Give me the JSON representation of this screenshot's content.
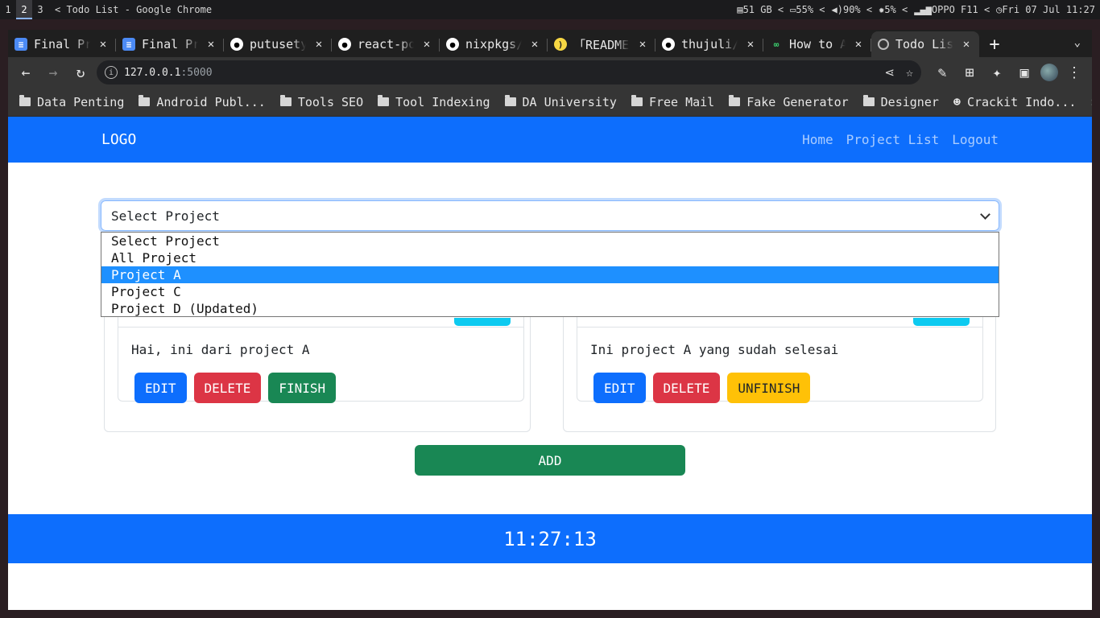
{
  "wm": {
    "workspaces": [
      "1",
      "2",
      "3"
    ],
    "title": "< Todo List - Google Chrome",
    "status": {
      "disk": "51 GB <",
      "battery": "55% <",
      "volume": "90% <",
      "brightness": "5% <",
      "network": "OPPO F11 <",
      "clock": "Fri 07 Jul 11:27"
    }
  },
  "browser": {
    "tabs": [
      {
        "title": "Final Pro",
        "icon": "doc-icon"
      },
      {
        "title": "Final Pro",
        "icon": "doc-icon"
      },
      {
        "title": "putusetya",
        "icon": "github-icon"
      },
      {
        "title": "react-por",
        "icon": "github-icon"
      },
      {
        "title": "nixpkgs/R",
        "icon": "github-icon"
      },
      {
        "title": "「README」",
        "icon": "banana-icon"
      },
      {
        "title": "thujuli/t",
        "icon": "github-icon"
      },
      {
        "title": "How to Ad",
        "icon": "geeks-icon"
      },
      {
        "title": "Todo List",
        "icon": "globe-icon"
      }
    ],
    "url_host": "127.0.0.1",
    "url_port": ":5000",
    "bookmarks": [
      "Data Penting",
      "Android Publ...",
      "Tools SEO",
      "Tool Indexing",
      "DA University",
      "Free Mail",
      "Fake Generator",
      "Designer",
      "Crackit Indo..."
    ],
    "bookmarks_more": "»"
  },
  "navbar": {
    "logo": "LOGO",
    "links": [
      "Home",
      "Project List",
      "Logout"
    ]
  },
  "project_select": {
    "value": "Select Project",
    "options": [
      "Select Project",
      "All Project",
      "Project A",
      "Project C",
      "Project D (Updated)"
    ],
    "highlighted": "Project A"
  },
  "cards": [
    {
      "text": "Hai, ini dari project A",
      "buttons": [
        "EDIT",
        "DELETE",
        "FINISH"
      ]
    },
    {
      "text": "Ini project A yang sudah selesai",
      "buttons": [
        "EDIT",
        "DELETE",
        "UNFINISH"
      ]
    }
  ],
  "add_label": "ADD",
  "footer_clock": "11:27:13",
  "colors": {
    "primary": "#0d6efd",
    "danger": "#dc3545",
    "success": "#198754",
    "warning": "#ffc107",
    "highlight": "#1e90ff"
  }
}
